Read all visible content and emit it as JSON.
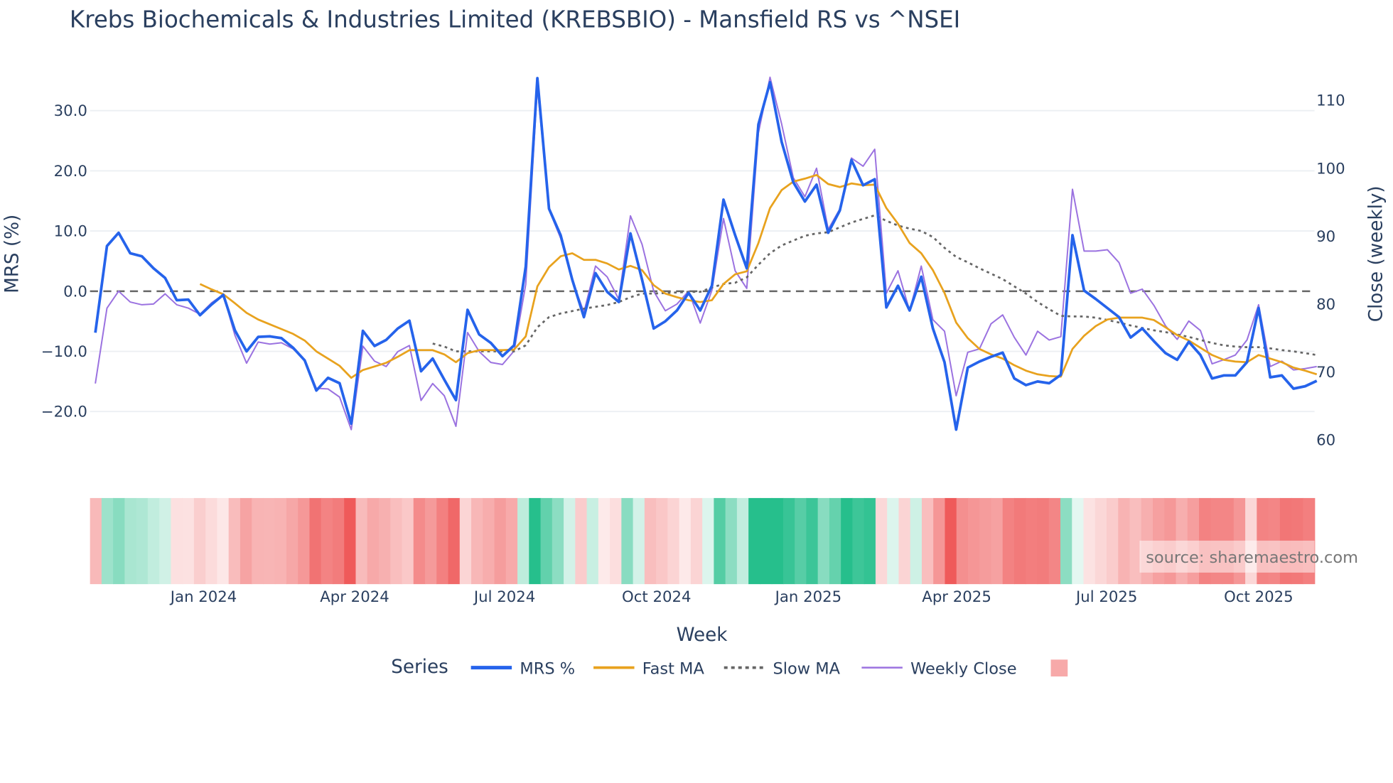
{
  "chart_data": {
    "type": "line",
    "title": "Krebs Biochemicals & Industries Limited (KREBSBIO) - Mansfield RS vs ^NSEI",
    "xlabel": "Week",
    "ylabel": "MRS (%)",
    "y2label": "Close (weekly)",
    "x_start": "2023-10-27",
    "x_step": "1 week",
    "x_ticks": [
      "Jan 2024",
      "Apr 2024",
      "Jul 2024",
      "Oct 2024",
      "Jan 2025",
      "Apr 2025",
      "Jul 2025",
      "Oct 2025"
    ],
    "y_ticks": [
      "30.0",
      "20.0",
      "10.0",
      "0.0",
      "−10.0",
      "−20.0"
    ],
    "y_tick_values": [
      30,
      20,
      10,
      0,
      -10,
      -20
    ],
    "y2_ticks": [
      "110",
      "100",
      "90",
      "80",
      "70",
      "60"
    ],
    "y2_tick_values": [
      110,
      100,
      90,
      80,
      70,
      60
    ],
    "ylim": [
      -25,
      38
    ],
    "y2lim": [
      58,
      115
    ],
    "grid": true,
    "reference_line": 0,
    "legend_title": "Series",
    "legend_placement": "bottom-center",
    "series": [
      {
        "name": "MRS %",
        "axis": "left",
        "color": "#2563eb",
        "start_index": 0,
        "values": [
          -6.9,
          7.5,
          9.7,
          6.3,
          5.8,
          3.8,
          2.2,
          -1.5,
          -1.4,
          -4,
          -2.2,
          -0.6,
          -6.5,
          -10,
          -7.6,
          -7.5,
          -7.8,
          -9.4,
          -11.5,
          -16.5,
          -14.4,
          -15.3,
          -22,
          -6.6,
          -9.1,
          -8.1,
          -6.2,
          -4.9,
          -13.3,
          -11.2,
          -14.7,
          -18.1,
          -3.1,
          -7.2,
          -8.6,
          -10.8,
          -9,
          4.1,
          35.4,
          13.7,
          9.3,
          1.9,
          -4.3,
          3,
          -0.1,
          -1.8,
          9.6,
          1.9,
          -6.2,
          -5,
          -3.2,
          -0.3,
          -3.2,
          0.9,
          15.2,
          9.3,
          3.8,
          27.7,
          34.7,
          24.8,
          18.1,
          14.9,
          17.7,
          9.7,
          13.4,
          21.8,
          17.6,
          18.6,
          -2.7,
          0.9,
          -3.2,
          2.4,
          -6.2,
          -11.8,
          -23,
          -12.7,
          -11.7,
          -10.9,
          -10.2,
          -14.5,
          -15.6,
          -15,
          -15.3,
          -13.9,
          9.3,
          0.1,
          -1.3,
          -2.8,
          -4.3,
          -7.7,
          -6.2,
          -8.3,
          -10.3,
          -11.4,
          -8.4,
          -10.6,
          -14.5,
          -14,
          -14,
          -11.8,
          -2.8,
          -14.3,
          -14,
          -16.2,
          -15.8,
          -14.9
        ]
      },
      {
        "name": "Fast MA",
        "axis": "left",
        "color": "#e8a21e",
        "start_index": 9,
        "values": [
          1.2,
          0.3,
          -0.5,
          -2,
          -3.6,
          -4.7,
          -5.5,
          -6.3,
          -7.1,
          -8.2,
          -10,
          -11.2,
          -12.4,
          -14.4,
          -13.1,
          -12.5,
          -11.9,
          -10.9,
          -9.8,
          -9.8,
          -9.8,
          -10.5,
          -11.8,
          -10.3,
          -9.8,
          -9.8,
          -9.8,
          -9.7,
          -7.5,
          0.8,
          4,
          5.8,
          6.3,
          5.2,
          5.2,
          4.6,
          3.6,
          4.2,
          3.5,
          1,
          -0.4,
          -1,
          -1.5,
          -1.8,
          -1.5,
          1.2,
          2.8,
          3.3,
          8,
          13.8,
          16.8,
          18.2,
          18.7,
          19.3,
          17.8,
          17.3,
          17.9,
          17.6,
          17.7,
          13.8,
          11.2,
          8,
          6.3,
          3.5,
          -0.3,
          -5.2,
          -7.8,
          -9.6,
          -10.5,
          -11.2,
          -12.3,
          -13.2,
          -13.8,
          -14.1,
          -14.2,
          -9.6,
          -7.4,
          -5.8,
          -4.7,
          -4.4,
          -4.4,
          -4.4,
          -4.8,
          -6,
          -7.3,
          -8.2,
          -9.4,
          -10.6,
          -11.4,
          -11.7,
          -11.8,
          -10.6,
          -11.2,
          -11.8,
          -12.7,
          -13.2,
          -13.8
        ]
      },
      {
        "name": "Slow MA",
        "axis": "left",
        "color": "#666666",
        "dash": true,
        "start_index": 29,
        "values": [
          -8.7,
          -9.2,
          -10,
          -10,
          -10,
          -10,
          -10,
          -10,
          -9,
          -6,
          -4.3,
          -3.7,
          -3.3,
          -2.9,
          -2.6,
          -2.3,
          -1.8,
          -1,
          -0.4,
          -0.4,
          -0.3,
          -0.2,
          -0.1,
          -0.1,
          0.6,
          1.2,
          1.4,
          2.3,
          4.4,
          6.3,
          7.6,
          8.4,
          9.2,
          9.6,
          9.8,
          10.6,
          11.4,
          12,
          12.6,
          11.7,
          10.9,
          10.4,
          10,
          9,
          7.2,
          5.7,
          4.8,
          3.8,
          2.9,
          2,
          0.8,
          -0.4,
          -1.8,
          -3,
          -4.1,
          -4.2,
          -4.2,
          -4.4,
          -4.8,
          -5.2,
          -5.7,
          -6.1,
          -6.5,
          -6.8,
          -7.2,
          -7.6,
          -8.1,
          -8.6,
          -9,
          -9.2,
          -9.3,
          -9.3,
          -9.5,
          -9.8,
          -10,
          -10.3,
          -10.6
        ]
      },
      {
        "name": "Weekly Close",
        "axis": "right",
        "color": "#9b72e0",
        "start_index": 0,
        "values": [
          68.3,
          79.4,
          81.9,
          80.3,
          79.9,
          80,
          81.5,
          79.9,
          79.4,
          78.5,
          80.2,
          81.4,
          75.4,
          71.3,
          74.4,
          74.1,
          74.3,
          73.4,
          71.8,
          67.6,
          67.5,
          66.3,
          61.5,
          73.8,
          71.6,
          70.8,
          73,
          73.9,
          65.8,
          68.3,
          66.5,
          62,
          75.8,
          73,
          71.4,
          71.1,
          73.1,
          82.9,
          112,
          93.9,
          89.7,
          83.5,
          78.8,
          85.6,
          84,
          80.7,
          93,
          88.8,
          81.9,
          79,
          80,
          81.9,
          77.2,
          82,
          92.6,
          84.9,
          82.3,
          105.2,
          113.4,
          106.5,
          98.6,
          95.8,
          100,
          91,
          94,
          101.5,
          100.3,
          102.8,
          81.6,
          84.9,
          79,
          85.6,
          77.7,
          76,
          66.5,
          72.9,
          73.4,
          77.1,
          78.4,
          75.1,
          72.5,
          76,
          74.7,
          75.2,
          96.9,
          87.8,
          87.8,
          88,
          86.1,
          81.6,
          82.2,
          79.8,
          76.8,
          74.8,
          77.5,
          76.1,
          71.2,
          71.8,
          72.5,
          74.7,
          79.9,
          70.8,
          71.6,
          70.3,
          70.5,
          70.8
        ]
      }
    ],
    "heatmap": {
      "source_series": "MRS %",
      "colors": {
        "positive": "#26bf8c",
        "negative": "#ef5a5a",
        "neutral": "#ffffff"
      }
    }
  },
  "watermark": "source: sharemaestro.com"
}
